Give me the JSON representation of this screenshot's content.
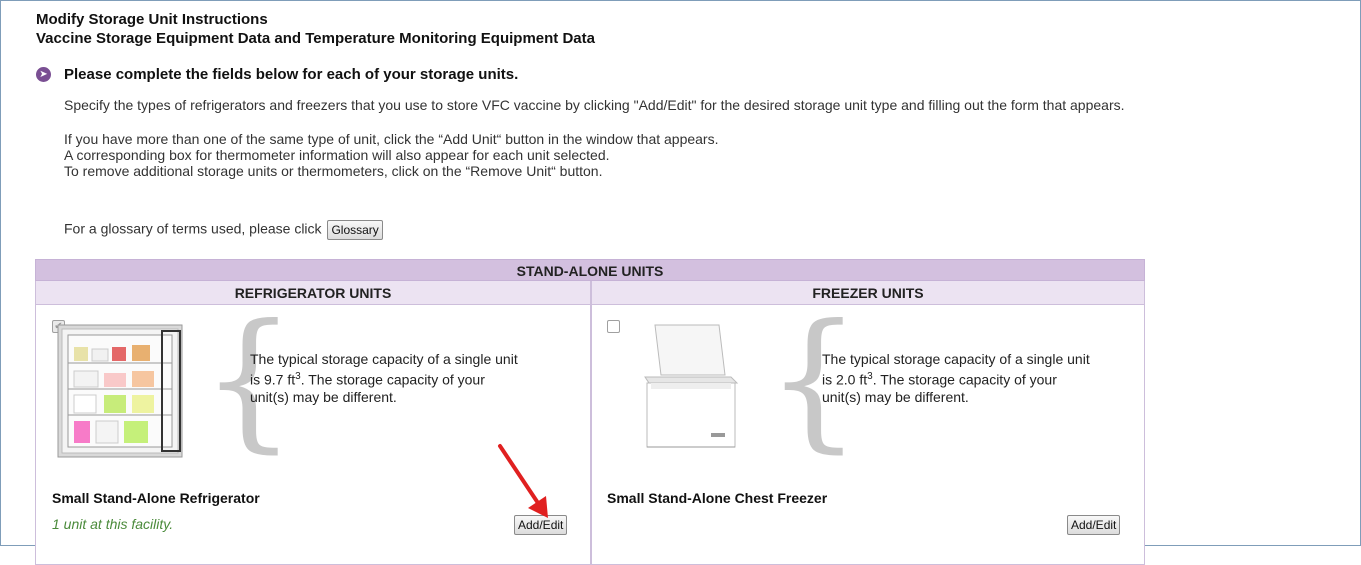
{
  "header": {
    "title": "Modify Storage Unit Instructions",
    "subtitle": "Vaccine Storage Equipment Data and Temperature Monitoring Equipment Data"
  },
  "instructions": {
    "heading": "Please complete the fields below for each of your storage units.",
    "specify": "Specify the types of refrigerators and freezers that you use to store VFC vaccine by clicking \"Add/Edit\" for the desired storage unit type and filling out the form that appears.",
    "line1": "If you have more than one of the same type of unit, click the “Add Unit“ button in the window that appears.",
    "line2": "A corresponding box for thermometer information will also appear for each unit selected.",
    "line3": "To remove additional storage units or thermometers, click on the “Remove Unit“ button.",
    "glossary_prompt": "For a glossary of terms used, please click",
    "glossary_button": "Glossary"
  },
  "table": {
    "section_header": "STAND-ALONE UNITS",
    "refrigerator_header": "REFRIGERATOR UNITS",
    "freezer_header": "FREEZER UNITS",
    "refrigerator": {
      "checked": true,
      "cap_pre": "The typical storage capacity of a single unit is 9.7 ft",
      "cap_sup": "3",
      "cap_post": ". The storage capacity of your unit(s) may be different.",
      "name": "Small Stand-Alone Refrigerator",
      "count": "1  unit at this facility.",
      "button": "Add/Edit"
    },
    "freezer": {
      "checked": false,
      "cap_pre": "The typical storage capacity of a single unit is 2.0 ft",
      "cap_sup": "3",
      "cap_post": ". The storage capacity of your unit(s) may be different.",
      "name": "Small Stand-Alone Chest Freezer",
      "button": "Add/Edit"
    }
  },
  "colors": {
    "section_header_bg": "#d3c0df",
    "sub_header_bg": "#ece3f2",
    "count_text": "#4a8a3a",
    "annotation_arrow": "#e02020"
  }
}
